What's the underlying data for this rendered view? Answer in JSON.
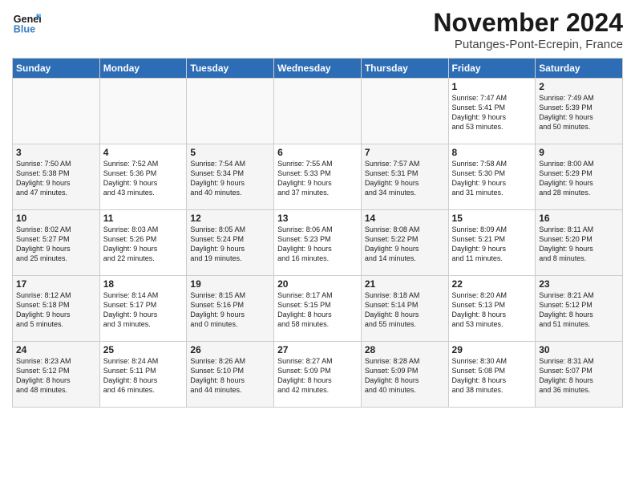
{
  "logo": {
    "line1": "General",
    "line2": "Blue"
  },
  "header": {
    "month": "November 2024",
    "location": "Putanges-Pont-Ecrepin, France"
  },
  "weekdays": [
    "Sunday",
    "Monday",
    "Tuesday",
    "Wednesday",
    "Thursday",
    "Friday",
    "Saturday"
  ],
  "weeks": [
    [
      {
        "day": "",
        "text": ""
      },
      {
        "day": "",
        "text": ""
      },
      {
        "day": "",
        "text": ""
      },
      {
        "day": "",
        "text": ""
      },
      {
        "day": "",
        "text": ""
      },
      {
        "day": "1",
        "text": "Sunrise: 7:47 AM\nSunset: 5:41 PM\nDaylight: 9 hours\nand 53 minutes."
      },
      {
        "day": "2",
        "text": "Sunrise: 7:49 AM\nSunset: 5:39 PM\nDaylight: 9 hours\nand 50 minutes."
      }
    ],
    [
      {
        "day": "3",
        "text": "Sunrise: 7:50 AM\nSunset: 5:38 PM\nDaylight: 9 hours\nand 47 minutes."
      },
      {
        "day": "4",
        "text": "Sunrise: 7:52 AM\nSunset: 5:36 PM\nDaylight: 9 hours\nand 43 minutes."
      },
      {
        "day": "5",
        "text": "Sunrise: 7:54 AM\nSunset: 5:34 PM\nDaylight: 9 hours\nand 40 minutes."
      },
      {
        "day": "6",
        "text": "Sunrise: 7:55 AM\nSunset: 5:33 PM\nDaylight: 9 hours\nand 37 minutes."
      },
      {
        "day": "7",
        "text": "Sunrise: 7:57 AM\nSunset: 5:31 PM\nDaylight: 9 hours\nand 34 minutes."
      },
      {
        "day": "8",
        "text": "Sunrise: 7:58 AM\nSunset: 5:30 PM\nDaylight: 9 hours\nand 31 minutes."
      },
      {
        "day": "9",
        "text": "Sunrise: 8:00 AM\nSunset: 5:29 PM\nDaylight: 9 hours\nand 28 minutes."
      }
    ],
    [
      {
        "day": "10",
        "text": "Sunrise: 8:02 AM\nSunset: 5:27 PM\nDaylight: 9 hours\nand 25 minutes."
      },
      {
        "day": "11",
        "text": "Sunrise: 8:03 AM\nSunset: 5:26 PM\nDaylight: 9 hours\nand 22 minutes."
      },
      {
        "day": "12",
        "text": "Sunrise: 8:05 AM\nSunset: 5:24 PM\nDaylight: 9 hours\nand 19 minutes."
      },
      {
        "day": "13",
        "text": "Sunrise: 8:06 AM\nSunset: 5:23 PM\nDaylight: 9 hours\nand 16 minutes."
      },
      {
        "day": "14",
        "text": "Sunrise: 8:08 AM\nSunset: 5:22 PM\nDaylight: 9 hours\nand 14 minutes."
      },
      {
        "day": "15",
        "text": "Sunrise: 8:09 AM\nSunset: 5:21 PM\nDaylight: 9 hours\nand 11 minutes."
      },
      {
        "day": "16",
        "text": "Sunrise: 8:11 AM\nSunset: 5:20 PM\nDaylight: 9 hours\nand 8 minutes."
      }
    ],
    [
      {
        "day": "17",
        "text": "Sunrise: 8:12 AM\nSunset: 5:18 PM\nDaylight: 9 hours\nand 5 minutes."
      },
      {
        "day": "18",
        "text": "Sunrise: 8:14 AM\nSunset: 5:17 PM\nDaylight: 9 hours\nand 3 minutes."
      },
      {
        "day": "19",
        "text": "Sunrise: 8:15 AM\nSunset: 5:16 PM\nDaylight: 9 hours\nand 0 minutes."
      },
      {
        "day": "20",
        "text": "Sunrise: 8:17 AM\nSunset: 5:15 PM\nDaylight: 8 hours\nand 58 minutes."
      },
      {
        "day": "21",
        "text": "Sunrise: 8:18 AM\nSunset: 5:14 PM\nDaylight: 8 hours\nand 55 minutes."
      },
      {
        "day": "22",
        "text": "Sunrise: 8:20 AM\nSunset: 5:13 PM\nDaylight: 8 hours\nand 53 minutes."
      },
      {
        "day": "23",
        "text": "Sunrise: 8:21 AM\nSunset: 5:12 PM\nDaylight: 8 hours\nand 51 minutes."
      }
    ],
    [
      {
        "day": "24",
        "text": "Sunrise: 8:23 AM\nSunset: 5:12 PM\nDaylight: 8 hours\nand 48 minutes."
      },
      {
        "day": "25",
        "text": "Sunrise: 8:24 AM\nSunset: 5:11 PM\nDaylight: 8 hours\nand 46 minutes."
      },
      {
        "day": "26",
        "text": "Sunrise: 8:26 AM\nSunset: 5:10 PM\nDaylight: 8 hours\nand 44 minutes."
      },
      {
        "day": "27",
        "text": "Sunrise: 8:27 AM\nSunset: 5:09 PM\nDaylight: 8 hours\nand 42 minutes."
      },
      {
        "day": "28",
        "text": "Sunrise: 8:28 AM\nSunset: 5:09 PM\nDaylight: 8 hours\nand 40 minutes."
      },
      {
        "day": "29",
        "text": "Sunrise: 8:30 AM\nSunset: 5:08 PM\nDaylight: 8 hours\nand 38 minutes."
      },
      {
        "day": "30",
        "text": "Sunrise: 8:31 AM\nSunset: 5:07 PM\nDaylight: 8 hours\nand 36 minutes."
      }
    ]
  ]
}
